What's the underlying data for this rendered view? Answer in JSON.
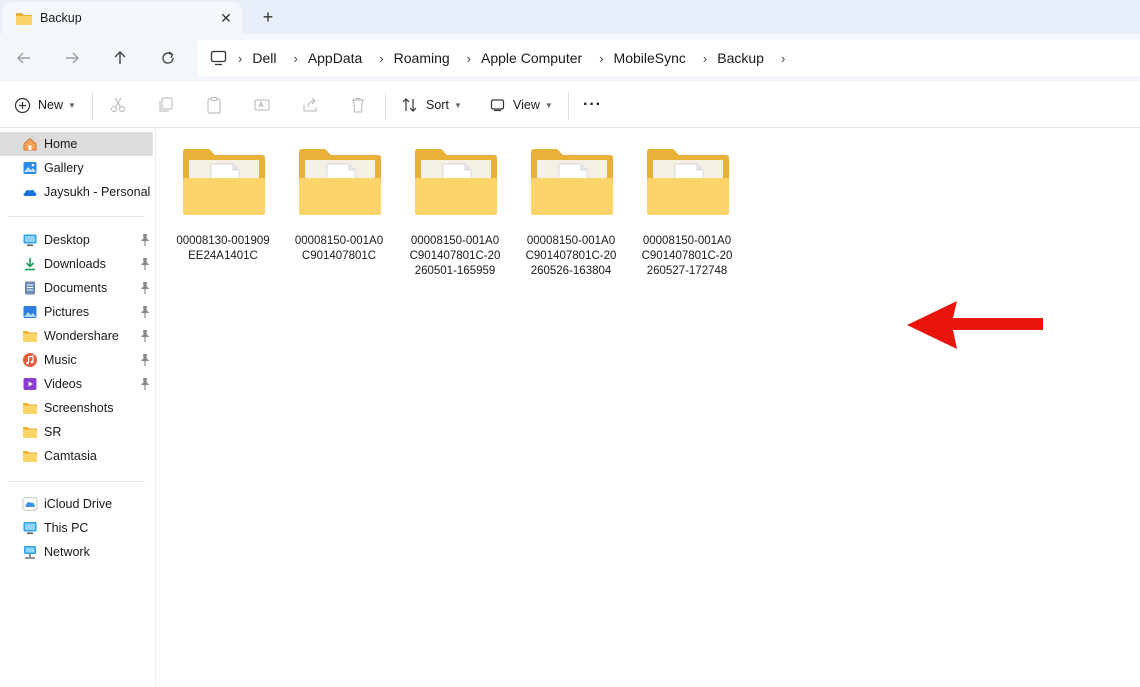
{
  "window": {
    "tab_title": "Backup",
    "tab_close": "✕",
    "new_tab": "+"
  },
  "nav": {
    "back": "←",
    "forward": "→",
    "up": "↑",
    "refresh": "↻"
  },
  "breadcrumbs": [
    "Dell",
    "AppData",
    "Roaming",
    "Apple Computer",
    "MobileSync",
    "Backup"
  ],
  "toolbar": {
    "new_label": "New",
    "sort_label": "Sort",
    "view_label": "View",
    "more_label": "···"
  },
  "sidebar": {
    "top": [
      {
        "label": "Home",
        "icon": "home-icon"
      },
      {
        "label": "Gallery",
        "icon": "gallery-icon"
      },
      {
        "label": "Jaysukh - Personal",
        "icon": "onedrive-icon"
      }
    ],
    "quick": [
      {
        "label": "Desktop",
        "icon": "desktop-icon",
        "pinned": true
      },
      {
        "label": "Downloads",
        "icon": "downloads-icon",
        "pinned": true
      },
      {
        "label": "Documents",
        "icon": "documents-icon",
        "pinned": true
      },
      {
        "label": "Pictures",
        "icon": "pictures-icon",
        "pinned": true
      },
      {
        "label": "Wondershare",
        "icon": "folder-icon",
        "pinned": true
      },
      {
        "label": "Music",
        "icon": "music-icon",
        "pinned": true
      },
      {
        "label": "Videos",
        "icon": "videos-icon",
        "pinned": true
      },
      {
        "label": "Screenshots",
        "icon": "folder-icon",
        "pinned": false
      },
      {
        "label": "SR",
        "icon": "folder-icon",
        "pinned": false
      },
      {
        "label": "Camtasia",
        "icon": "folder-icon",
        "pinned": false
      }
    ],
    "bottom": [
      {
        "label": "iCloud Drive",
        "icon": "icloud-icon"
      },
      {
        "label": "This PC",
        "icon": "this-pc-icon"
      },
      {
        "label": "Network",
        "icon": "network-icon"
      }
    ]
  },
  "files": [
    {
      "line1": "00008130-001909",
      "line2": "EE24A1401C",
      "line3": ""
    },
    {
      "line1": "00008150-001A0",
      "line2": "C901407801C",
      "line3": ""
    },
    {
      "line1": "00008150-001A0",
      "line2": "C901407801C-20",
      "line3": "260501-165959"
    },
    {
      "line1": "00008150-001A0",
      "line2": "C901407801C-20",
      "line3": "260526-163804"
    },
    {
      "line1": "00008150-001A0",
      "line2": "C901407801C-20",
      "line3": "260527-172748"
    }
  ],
  "colors": {
    "folder_back": "#e8b23a",
    "folder_front": "#fcd46a",
    "arrow": "#e8160c",
    "selection": "#dcdcdc"
  }
}
